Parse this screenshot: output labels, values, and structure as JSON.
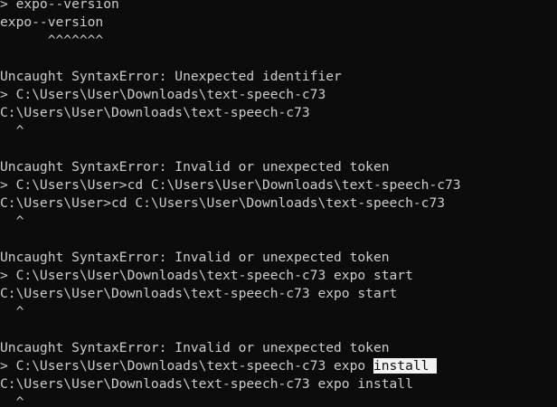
{
  "terminal": {
    "lines": [
      "> expo--version",
      "expo--version",
      "      ^^^^^^^",
      "",
      "Uncaught SyntaxError: Unexpected identifier",
      "> C:\\Users\\User\\Downloads\\text-speech-c73",
      "C:\\Users\\User\\Downloads\\text-speech-c73",
      "  ^",
      "",
      "Uncaught SyntaxError: Invalid or unexpected token",
      "> C:\\Users\\User>cd C:\\Users\\User\\Downloads\\text-speech-c73",
      "C:\\Users\\User>cd C:\\Users\\User\\Downloads\\text-speech-c73",
      "  ^",
      "",
      "Uncaught SyntaxError: Invalid or unexpected token",
      "> C:\\Users\\User\\Downloads\\text-speech-c73 expo start",
      "C:\\Users\\User\\Downloads\\text-speech-c73 expo start",
      "  ^",
      "",
      "Uncaught SyntaxError: Invalid or unexpected token"
    ],
    "current_prompt_prefix": "> C:\\Users\\User\\Downloads\\text-speech-c73 expo ",
    "current_prompt_selected": "install ",
    "echo_line": "C:\\Users\\User\\Downloads\\text-speech-c73 expo install",
    "caret_line": "  ^"
  },
  "colors": {
    "background": "#0c0c0c",
    "foreground": "#cccccc",
    "selection_bg": "#f2f2f2",
    "selection_fg": "#0c0c0c"
  }
}
